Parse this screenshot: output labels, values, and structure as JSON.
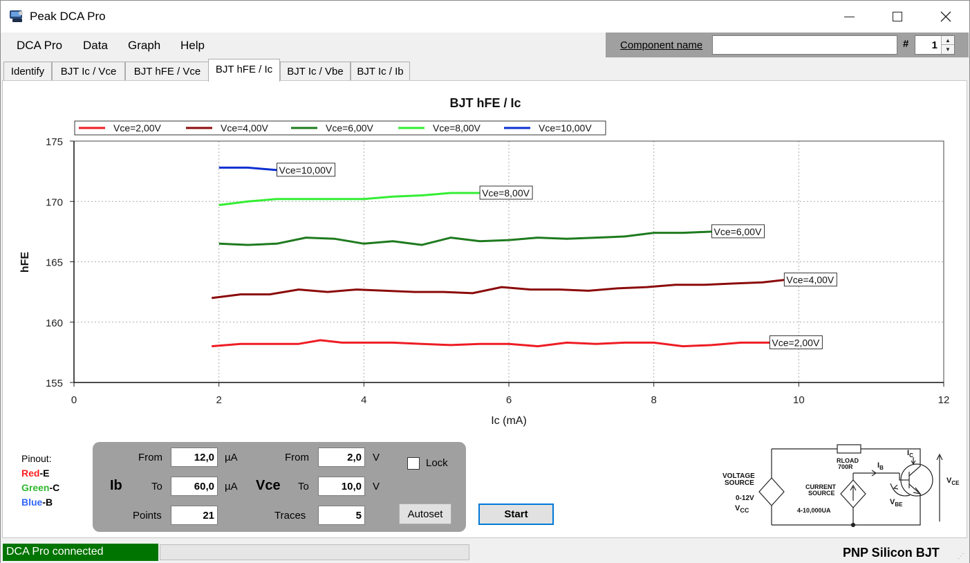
{
  "window": {
    "title": "Peak DCA Pro"
  },
  "menu": {
    "items": [
      "DCA Pro",
      "Data",
      "Graph",
      "Help"
    ]
  },
  "component": {
    "label": "Component name",
    "value": "",
    "hash_label": "#",
    "number": "1"
  },
  "tabs": [
    {
      "label": "Identify"
    },
    {
      "label": "BJT Ic / Vce"
    },
    {
      "label": "BJT hFE / Vce"
    },
    {
      "label": "BJT hFE / Ic"
    },
    {
      "label": "BJT Ic / Vbe"
    },
    {
      "label": "BJT Ic / Ib"
    }
  ],
  "active_tab": "BJT hFE / Ic",
  "chart_data": {
    "type": "line",
    "title": "BJT hFE / Ic",
    "xlabel": "Ic (mA)",
    "ylabel": "hFE",
    "xlim": [
      0,
      12
    ],
    "ylim": [
      155,
      175
    ],
    "x_ticks": [
      "0",
      "2",
      "4",
      "6",
      "8",
      "10",
      "12"
    ],
    "y_ticks": [
      "155",
      "160",
      "165",
      "170",
      "175"
    ],
    "grid": true,
    "legend": "top",
    "series": [
      {
        "name": "Vce=2,00V",
        "color": "#ee1c24",
        "x": [
          1.9,
          2.3,
          2.7,
          3.1,
          3.4,
          3.7,
          4.0,
          4.4,
          4.8,
          5.2,
          5.6,
          6.0,
          6.4,
          6.8,
          7.2,
          7.6,
          8.0,
          8.4,
          8.8,
          9.2,
          9.6
        ],
        "y": [
          158.0,
          158.2,
          158.2,
          158.2,
          158.5,
          158.3,
          158.3,
          158.3,
          158.2,
          158.1,
          158.2,
          158.2,
          158.0,
          158.3,
          158.2,
          158.3,
          158.3,
          158.0,
          158.1,
          158.3,
          158.3
        ]
      },
      {
        "name": "Vce=4,00V",
        "color": "#8b0a0a",
        "x": [
          1.9,
          2.3,
          2.7,
          3.1,
          3.5,
          3.9,
          4.3,
          4.7,
          5.1,
          5.5,
          5.9,
          6.3,
          6.7,
          7.1,
          7.5,
          7.9,
          8.3,
          8.7,
          9.1,
          9.5,
          9.8
        ],
        "y": [
          162.0,
          162.3,
          162.3,
          162.7,
          162.5,
          162.7,
          162.6,
          162.5,
          162.5,
          162.4,
          162.9,
          162.7,
          162.7,
          162.6,
          162.8,
          162.9,
          163.1,
          163.1,
          163.2,
          163.3,
          163.5
        ]
      },
      {
        "name": "Vce=6,00V",
        "color": "#1e7a1e",
        "x": [
          2.0,
          2.4,
          2.8,
          3.2,
          3.6,
          4.0,
          4.4,
          4.8,
          5.2,
          5.6,
          6.0,
          6.4,
          6.8,
          7.2,
          7.6,
          8.0,
          8.4,
          8.8
        ],
        "y": [
          166.5,
          166.4,
          166.5,
          167.0,
          166.9,
          166.5,
          166.7,
          166.4,
          167.0,
          166.7,
          166.8,
          167.0,
          166.9,
          167.0,
          167.1,
          167.4,
          167.4,
          167.5
        ]
      },
      {
        "name": "Vce=8,00V",
        "color": "#33ee33",
        "x": [
          2.0,
          2.4,
          2.8,
          3.2,
          3.6,
          4.0,
          4.4,
          4.8,
          5.2,
          5.6
        ],
        "y": [
          169.7,
          170.0,
          170.2,
          170.2,
          170.2,
          170.2,
          170.4,
          170.5,
          170.7,
          170.7
        ]
      },
      {
        "name": "Vce=10,00V",
        "color": "#0b2fd0",
        "x": [
          2.0,
          2.4,
          2.8
        ],
        "y": [
          172.8,
          172.8,
          172.6
        ]
      }
    ]
  },
  "pinout": {
    "title": "Pinout:",
    "pins": [
      {
        "color": "Red",
        "pin": "-E"
      },
      {
        "color": "Green",
        "pin": "-C"
      },
      {
        "color": "Blue",
        "pin": "-B"
      }
    ]
  },
  "params": {
    "ib": {
      "label": "Ib",
      "from_label": "From",
      "from": "12,0",
      "from_unit": "µA",
      "to_label": "To",
      "to": "60,0",
      "to_unit": "µA",
      "points_label": "Points",
      "points": "21"
    },
    "vce": {
      "label": "Vce",
      "from_label": "From",
      "from": "2,0",
      "from_unit": "V",
      "to_label": "To",
      "to": "10,0",
      "to_unit": "V",
      "traces_label": "Traces",
      "traces": "5"
    },
    "lock_label": "Lock",
    "autoset_label": "Autoset"
  },
  "start_label": "Start",
  "circuit": {
    "voltage_source": [
      "VOLTAGE",
      "SOURCE"
    ],
    "voltage_range": "0-12V",
    "vcc": "V",
    "vcc_sub": "CC",
    "current_source": [
      "CURRENT",
      "SOURCE"
    ],
    "current_range": "4-10,000UA",
    "rload": [
      "RLOAD",
      "700R"
    ],
    "ib": "I",
    "ib_sub": "B",
    "ic": "I",
    "ic_sub": "C",
    "vce": "V",
    "vce_sub": "CE",
    "vbe": "V",
    "vbe_sub": "BE"
  },
  "status": {
    "connection": "DCA Pro connected",
    "component_type": "PNP Silicon BJT",
    "progress": 0
  }
}
